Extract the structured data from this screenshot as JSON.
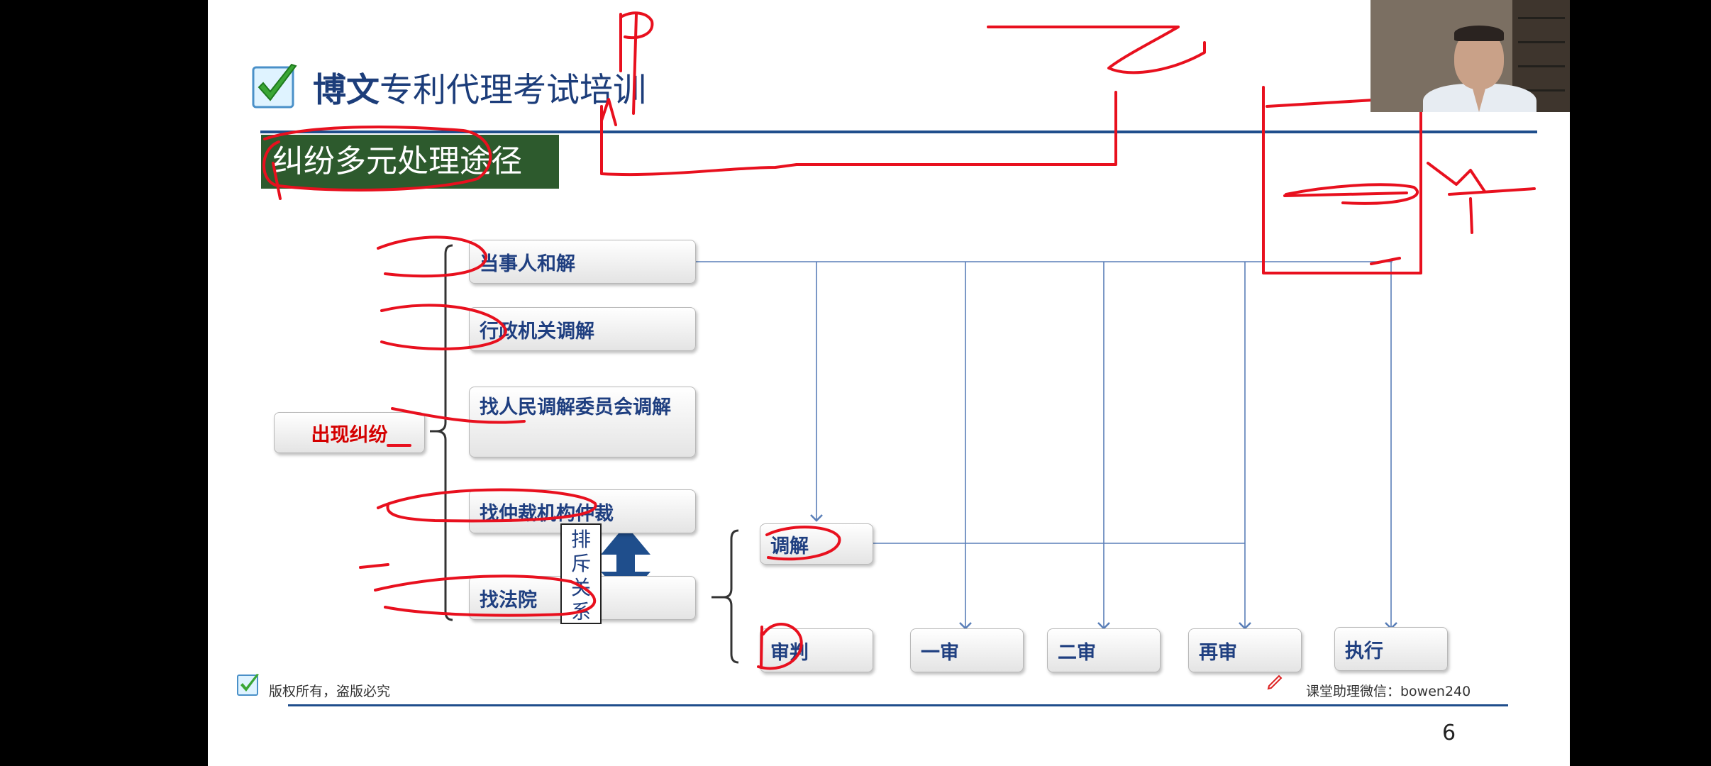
{
  "brand": {
    "name_bold": "博文",
    "name_rest": "专利代理考试培训"
  },
  "section_title": "纠纷多元处理途径",
  "diagram": {
    "root": "出现纠纷",
    "paths": [
      "当事人和解",
      "行政机关调解",
      "找人民调解委员会调解",
      "找仲裁机构仲裁",
      "找法院"
    ],
    "exclusive_label": "排斥关系",
    "court_options": [
      "调解",
      "审判"
    ],
    "trial_stages": [
      "一审",
      "二审",
      "再审",
      "执行"
    ]
  },
  "footer": {
    "left": "版权所有，盗版必究",
    "right": "课堂助理微信：bowen240",
    "page_number": "6"
  },
  "colors": {
    "brand_blue": "#1f4e8c",
    "banner_green": "#2d5a2d",
    "box_text_blue": "#1f3f80",
    "root_red": "#d40000",
    "connector_blue": "#5a7fb8",
    "ink_red": "#e8101e"
  },
  "icons": {
    "brand": "green-check-icon",
    "footer": "green-check-icon",
    "exclusive": "double-arrow-vertical-icon",
    "annotation": "pen-icon"
  }
}
